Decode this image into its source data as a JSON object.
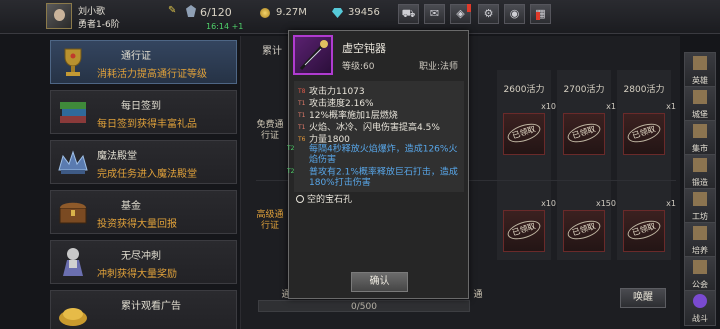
{
  "header": {
    "player_name": "刘小歌",
    "player_rank": "勇者1-6阶",
    "stamina": "6/120",
    "stamina_regen": "16:14 +1",
    "gold": "9.27M",
    "gems": "39456"
  },
  "sidebar_left": [
    {
      "title": "通行证",
      "desc": "消耗活力提高通行证等级"
    },
    {
      "title": "每日签到",
      "desc": "每日签到获得丰富礼品"
    },
    {
      "title": "魔法殿堂",
      "desc": "完成任务进入魔法殿堂"
    },
    {
      "title": "基金",
      "desc": "投资获得大量回报"
    },
    {
      "title": "无尽冲刺",
      "desc": "冲刺获得大量奖励"
    },
    {
      "title": "累计观看广告",
      "desc": ""
    }
  ],
  "pass_panel": {
    "tab_partial": "累计",
    "costs": [
      "2600活力",
      "2700活力",
      "2800活力"
    ],
    "free_row_label": "免费通行证",
    "premium_row_label": "高级通行证",
    "claimed_label": "已领取",
    "multipliers_top": [
      "x10",
      "x1",
      "x1"
    ],
    "multipliers_bottom": [
      "x10",
      "x150",
      "x1"
    ],
    "partial_label_left": "通",
    "partial_label_right": "通",
    "progress": "0/500",
    "wake_button": "唤醒"
  },
  "sidebar_right": [
    "英雄",
    "城堡",
    "集市",
    "锻造",
    "工坊",
    "培养",
    "公会",
    "战斗"
  ],
  "item_popup": {
    "name": "虚空钝器",
    "level": "等级:60",
    "class": "职业:法师",
    "stats": [
      {
        "tier": "T8",
        "text": "攻击力11073",
        "style": "normal"
      },
      {
        "tier": "T1",
        "text": "攻击速度2.16%",
        "style": "normal"
      },
      {
        "tier": "T1",
        "text": "12%概率施加1层燃烧",
        "style": "normal"
      },
      {
        "tier": "T1",
        "text": "火焰、冰冷、闪电伤害提高4.5%",
        "style": "normal"
      },
      {
        "tier": "T6",
        "text": "力量1800",
        "style": "normal"
      },
      {
        "tier": "T2",
        "text": "每隔4秒释放火焰爆炸，造成126%火焰伤害",
        "style": "blue"
      },
      {
        "tier": "T2",
        "text": "普攻有2.1%概率释放巨石打击，造成180%打击伤害",
        "style": "blue"
      }
    ],
    "socket_label": "空的宝石孔",
    "confirm_button": "确认"
  }
}
